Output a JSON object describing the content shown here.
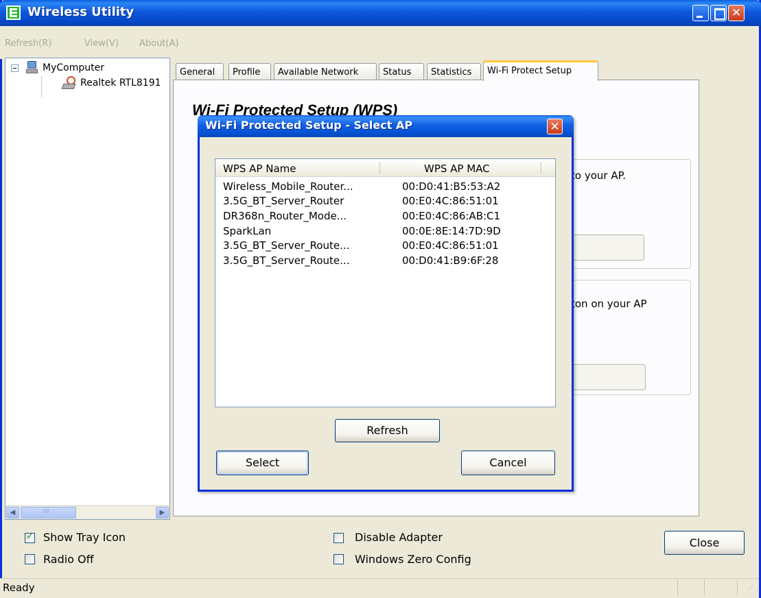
{
  "window": {
    "title": "Wireless Utility"
  },
  "menu": [
    "Refresh(R)",
    "View(V)",
    "About(A)"
  ],
  "tree": {
    "root": "MyComputer",
    "adapter": "Realtek RTL8191"
  },
  "tabs": [
    "General",
    "Profile",
    "Available Network",
    "Status",
    "Statistics",
    "Wi-Fi Protect Setup"
  ],
  "active_tab": "Wi-Fi Protect Setup",
  "wps": {
    "heading": "Wi-Fi Protected Setup (WPS)",
    "peek_text_1": "to your AP.",
    "peek_text_2": "ton on your AP"
  },
  "dialog": {
    "title": "Wi-Fi Protected Setup - Select AP",
    "columns": {
      "name": "WPS AP Name",
      "mac": "WPS AP MAC"
    },
    "rows": [
      {
        "name": "Wireless_Mobile_Router...",
        "mac": "00:D0:41:B5:53:A2"
      },
      {
        "name": "3.5G_BT_Server_Router",
        "mac": "00:E0:4C:86:51:01"
      },
      {
        "name": "DR368n_Router_Mode...",
        "mac": "00:E0:4C:86:AB:C1"
      },
      {
        "name": "SparkLan",
        "mac": "00:0E:8E:14:7D:9D"
      },
      {
        "name": "3.5G_BT_Server_Route...",
        "mac": "00:E0:4C:86:51:01"
      },
      {
        "name": "3.5G_BT_Server_Route...",
        "mac": "00:D0:41:B9:6F:28"
      }
    ],
    "refresh_label": "Refresh",
    "select_label": "Select",
    "cancel_label": "Cancel"
  },
  "options": {
    "show_tray_icon": {
      "label": "Show Tray Icon",
      "checked": true
    },
    "radio_off": {
      "label": "Radio Off",
      "checked": false
    },
    "disable_adapter": {
      "label": "Disable Adapter",
      "checked": false
    },
    "windows_zero_config": {
      "label": "Windows Zero Config",
      "checked": false
    }
  },
  "close_label": "Close",
  "status": "Ready",
  "colors": {
    "title_blue": "#0a5fe0",
    "close_red": "#c93b1b",
    "tab_highlight": "#ffc73c"
  }
}
